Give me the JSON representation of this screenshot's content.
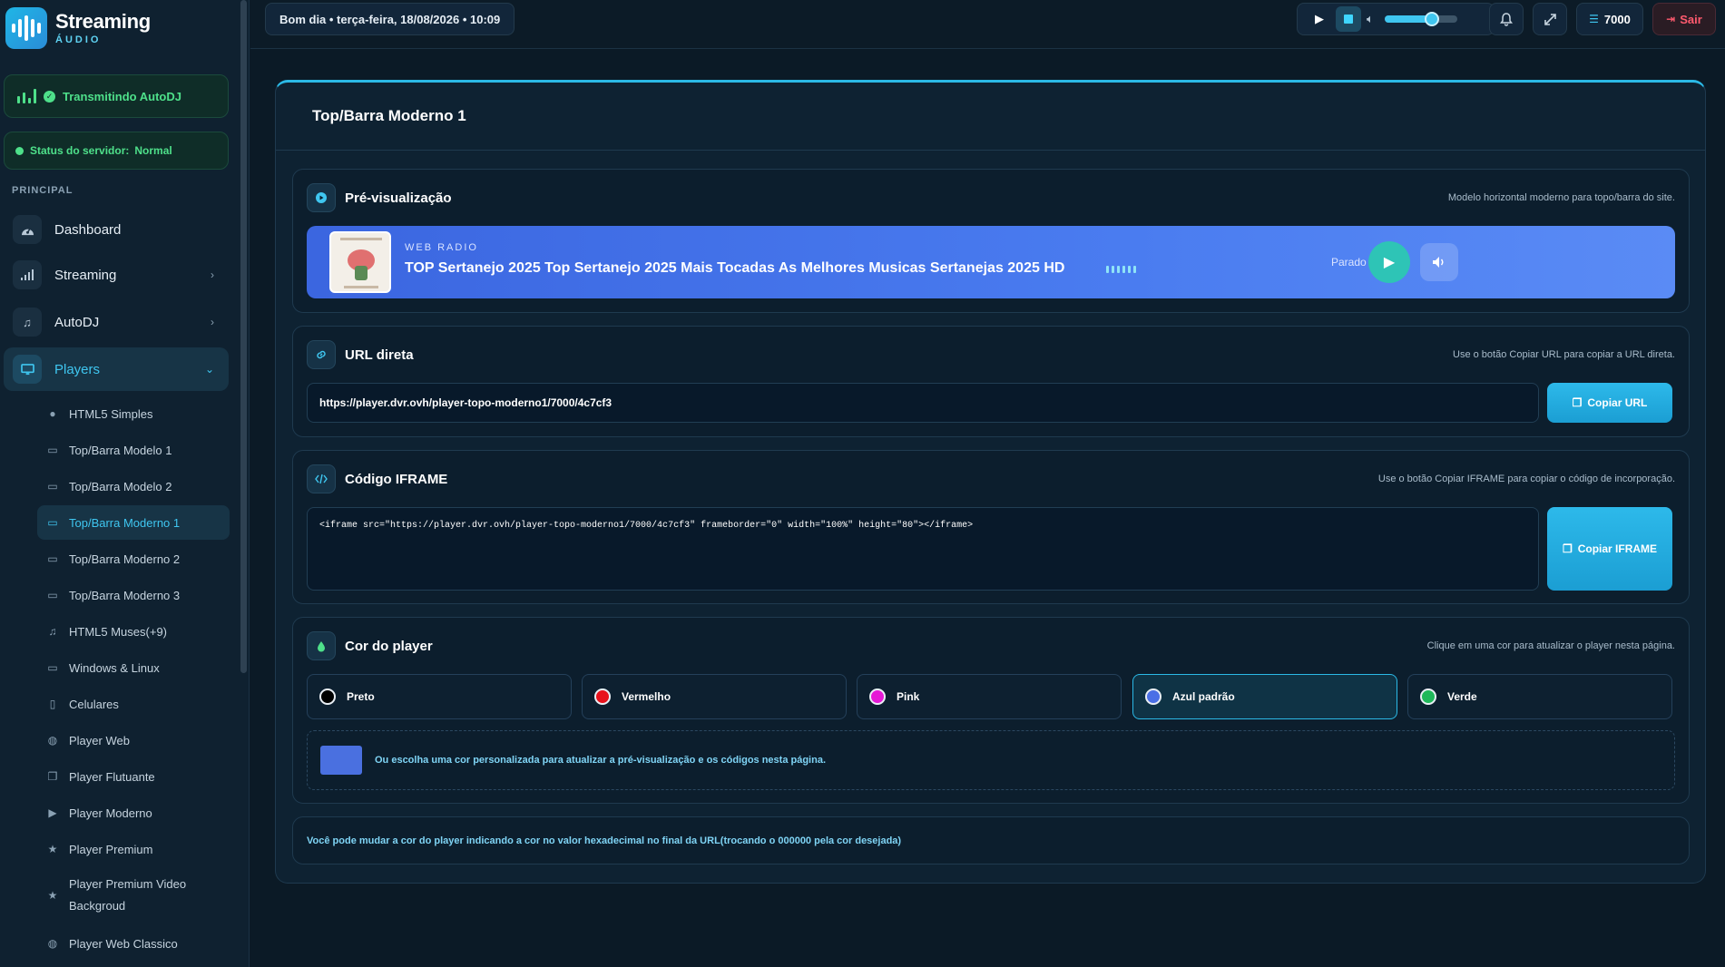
{
  "brand": {
    "title": "Streaming",
    "subtitle": "ÁUDIO"
  },
  "sidebar": {
    "autodj_label": "Transmitindo AutoDJ",
    "status_label": "Status do servidor:",
    "status_value": "Normal",
    "section": "PRINCIPAL",
    "nav": [
      {
        "label": "Dashboard",
        "icon": "dashboard-icon"
      },
      {
        "label": "Streaming",
        "icon": "signal-icon"
      },
      {
        "label": "AutoDJ",
        "icon": "music-note-icon"
      },
      {
        "label": "Players",
        "icon": "monitor-icon"
      }
    ],
    "players_sub": [
      {
        "label": "HTML5 Simples",
        "icon": "play-circle-icon"
      },
      {
        "label": "Top/Barra Modelo 1",
        "icon": "window-icon"
      },
      {
        "label": "Top/Barra Modelo 2",
        "icon": "window-icon"
      },
      {
        "label": "Top/Barra Moderno 1",
        "icon": "monitor-icon"
      },
      {
        "label": "Top/Barra Moderno 2",
        "icon": "monitor-icon"
      },
      {
        "label": "Top/Barra Moderno 3",
        "icon": "monitor-icon"
      },
      {
        "label": "HTML5 Muses(+9)",
        "icon": "music-note-icon"
      },
      {
        "label": "Windows & Linux",
        "icon": "monitor-icon"
      },
      {
        "label": "Celulares",
        "icon": "phone-icon"
      },
      {
        "label": "Player Web",
        "icon": "globe-icon"
      },
      {
        "label": "Player Flutuante",
        "icon": "copy-icon"
      },
      {
        "label": "Player Moderno",
        "icon": "play-icon"
      },
      {
        "label": "Player Premium",
        "icon": "star-icon"
      },
      {
        "label": "Player Premium Video Backgroud",
        "icon": "star-icon"
      },
      {
        "label": "Player Web Classico",
        "icon": "globe-icon"
      }
    ]
  },
  "topbar": {
    "greeting": "Bom dia • terça-feira, 18/08/2026 • 10:09",
    "volume": 0.65,
    "listeners": "7000",
    "logout": "Sair"
  },
  "page": {
    "title": "Top/Barra Moderno 1"
  },
  "preview": {
    "title": "Pré-visualização",
    "hint": "Modelo horizontal moderno para topo/barra do site.",
    "label": "WEB RADIO",
    "track": "TOP Sertanejo 2025 Top Sertanejo 2025 Mais Tocadas As Melhores Musicas Sertanejas 2025 HD",
    "status": "Parado"
  },
  "url": {
    "title": "URL direta",
    "hint": "Use o botão Copiar URL para copiar a URL direta.",
    "value": "https://player.dvr.ovh/player-topo-moderno1/7000/4c7cf3",
    "button": "Copiar URL"
  },
  "iframe": {
    "title": "Código IFRAME",
    "hint": "Use o botão Copiar IFRAME para copiar o código de incorporação.",
    "value": "<iframe src=\"https://player.dvr.ovh/player-topo-moderno1/7000/4c7cf3\" frameborder=\"0\" width=\"100%\" height=\"80\"></iframe>",
    "button": "Copiar IFRAME"
  },
  "colors": {
    "title": "Cor do player",
    "hint": "Clique em uma cor para atualizar o player nesta página.",
    "options": [
      {
        "label": "Preto",
        "color": "#000000"
      },
      {
        "label": "Vermelho",
        "color": "#e8121c"
      },
      {
        "label": "Pink",
        "color": "#e619d6"
      },
      {
        "label": "Azul padrão",
        "color": "#4a6fe6"
      },
      {
        "label": "Verde",
        "color": "#1fb85a"
      }
    ],
    "selected": "Azul padrão",
    "custom_color": "#4a70e0",
    "custom_text": "Ou escolha uma cor personalizada para atualizar a pré-visualização e os códigos nesta página."
  },
  "info": {
    "text": "Você pode mudar a cor do player indicando a cor no valor hexadecimal no final da URL(trocando o 000000 pela cor desejada)"
  }
}
